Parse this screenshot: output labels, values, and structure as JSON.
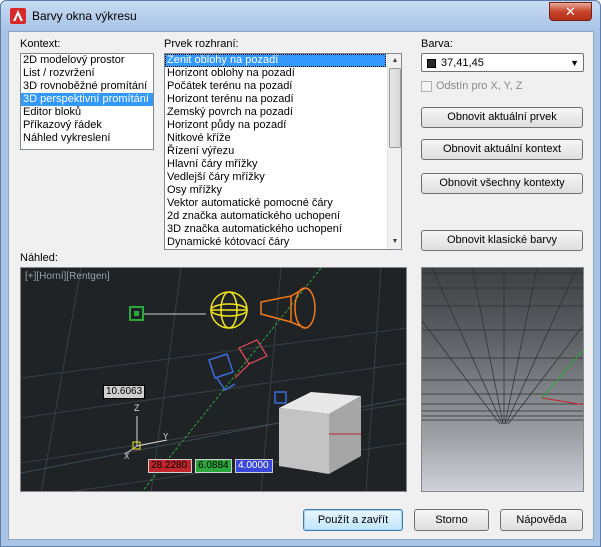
{
  "window": {
    "title": "Barvy okna výkresu",
    "close_glyph": "✕"
  },
  "context": {
    "label": "Kontext:",
    "items": [
      "2D modelový prostor",
      "List / rozvržení",
      "3D rovnoběžné promítání",
      "3D perspektivní promítání",
      "Editor bloků",
      "Příkazový řádek",
      "Náhled vykreslení"
    ],
    "selected_index": 3
  },
  "elements": {
    "label": "Prvek rozhraní:",
    "items": [
      "Zenit oblohy na pozadí",
      "Horizont oblohy na pozadí",
      "Počátek terénu na pozadí",
      "Horizont terénu na pozadí",
      "Zemský povrch na pozadí",
      "Horizont půdy na pozadí",
      "Nitkové kříže",
      "Řízení výřezu",
      "Hlavní čáry mřížky",
      "Vedlejší čáry mřížky",
      "Osy mřížky",
      "Vektor automatické pomocné čáry",
      "2d značka automatického uchopení",
      "3D značka automatického uchopení",
      "Dynamické kótovací čáry"
    ],
    "selected_index": 0
  },
  "color": {
    "label": "Barva:",
    "value": "37,41,45",
    "swatch": "#25292d",
    "tint_label": "Odstín pro X, Y, Z"
  },
  "buttons": {
    "restore_element": "Obnovit aktuální prvek",
    "restore_context": "Obnovit aktuální kontext",
    "restore_all": "Obnovit všechny kontexty",
    "restore_classic": "Obnovit klasické barvy",
    "apply_close": "Použít a zavřít",
    "cancel": "Storno",
    "help": "Nápověda"
  },
  "preview": {
    "label": "Náhled:",
    "viewport_label": "[+][Horní][Rentgen]",
    "dimension": "10.6063",
    "coord_x": "28.2280",
    "coord_y": "6.0884",
    "coord_z": "4.0000",
    "axis_z": "Z",
    "axis_x": "X",
    "axis_y": "Y",
    "x_color": "#c0262c",
    "y_color": "#2aa83c",
    "z_color": "#3a47d8"
  }
}
